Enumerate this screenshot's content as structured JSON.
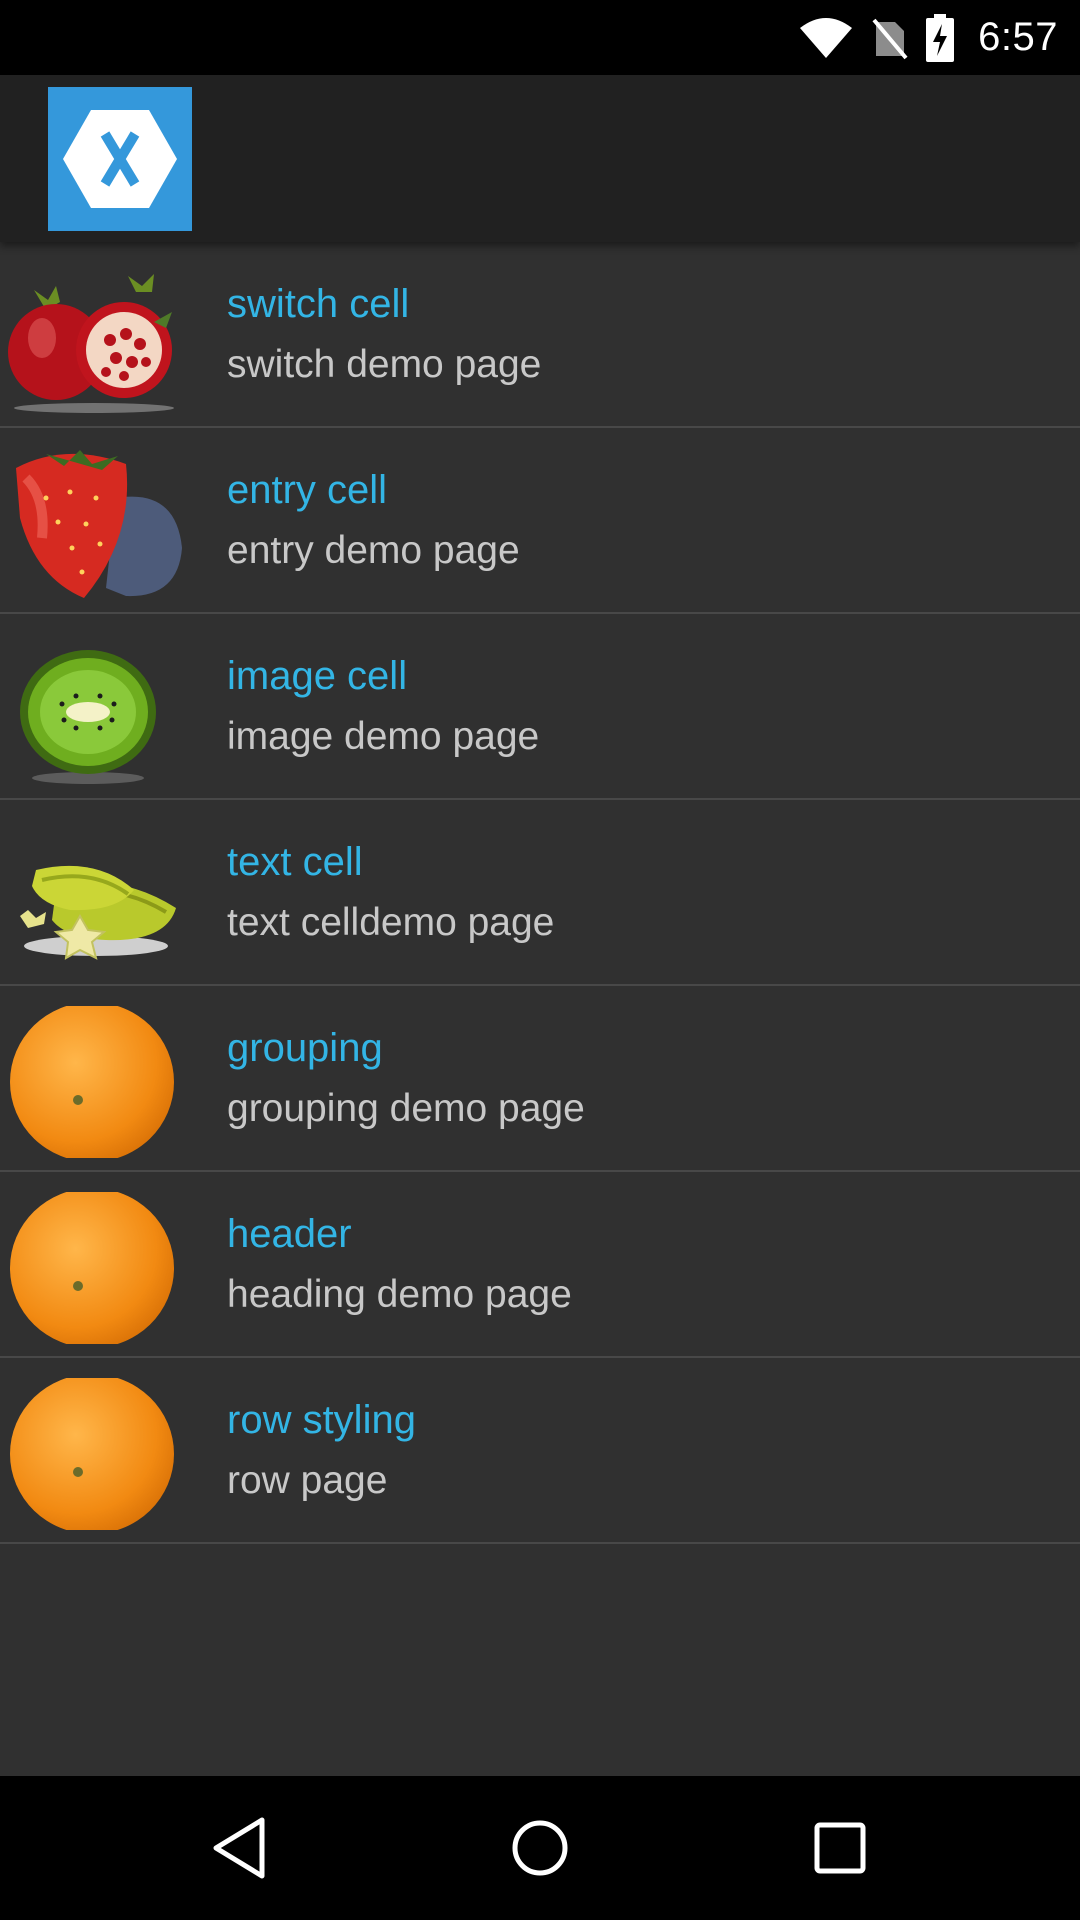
{
  "status_bar": {
    "time": "6:57",
    "icons": [
      "wifi-icon",
      "no-sim-icon",
      "battery-charging-icon"
    ]
  },
  "action_bar": {
    "logo_icon": "xamarin-logo-icon"
  },
  "cells": [
    {
      "title": "switch cell",
      "detail": "switch demo page",
      "image": "pomegranate"
    },
    {
      "title": "entry cell",
      "detail": "entry demo page",
      "image": "strawberry"
    },
    {
      "title": "image cell",
      "detail": "image demo page",
      "image": "kiwi"
    },
    {
      "title": "text cell",
      "detail": "text celldemo page",
      "image": "starfruit"
    },
    {
      "title": "grouping",
      "detail": "grouping demo page",
      "image": "orange"
    },
    {
      "title": "header",
      "detail": "heading demo page",
      "image": "orange"
    },
    {
      "title": "row styling",
      "detail": "row page",
      "image": "orange"
    }
  ],
  "nav_bar": {
    "buttons": [
      "back-icon",
      "home-icon",
      "recents-icon"
    ]
  },
  "colors": {
    "accent": "#33b5e5",
    "detail_text": "#c8c8c8",
    "background": "#303030",
    "action_bar": "#212121",
    "logo": "#3498db"
  }
}
